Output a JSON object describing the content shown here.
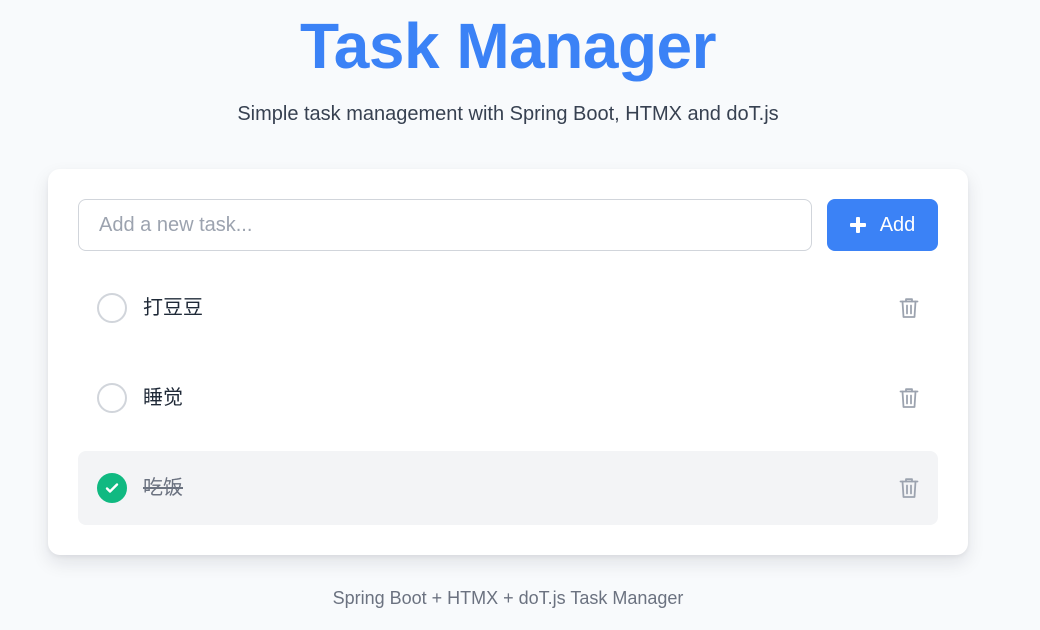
{
  "header": {
    "title": "Task Manager",
    "subtitle": "Simple task management with Spring Boot, HTMX and doT.js"
  },
  "new_task": {
    "placeholder": "Add a new task...",
    "value": "",
    "add_label": "Add",
    "add_icon": "plus-icon"
  },
  "tasks": [
    {
      "text": "打豆豆",
      "completed": false,
      "delete_icon": "trash-icon"
    },
    {
      "text": "睡觉",
      "completed": false,
      "delete_icon": "trash-icon"
    },
    {
      "text": "吃饭",
      "completed": true,
      "delete_icon": "trash-icon"
    }
  ],
  "footer": {
    "text": "Spring Boot + HTMX + doT.js Task Manager"
  },
  "colors": {
    "accent": "#3b82f6",
    "done_check": "#10b981",
    "done_row": "#f3f4f6",
    "background": "#f8fafc"
  }
}
